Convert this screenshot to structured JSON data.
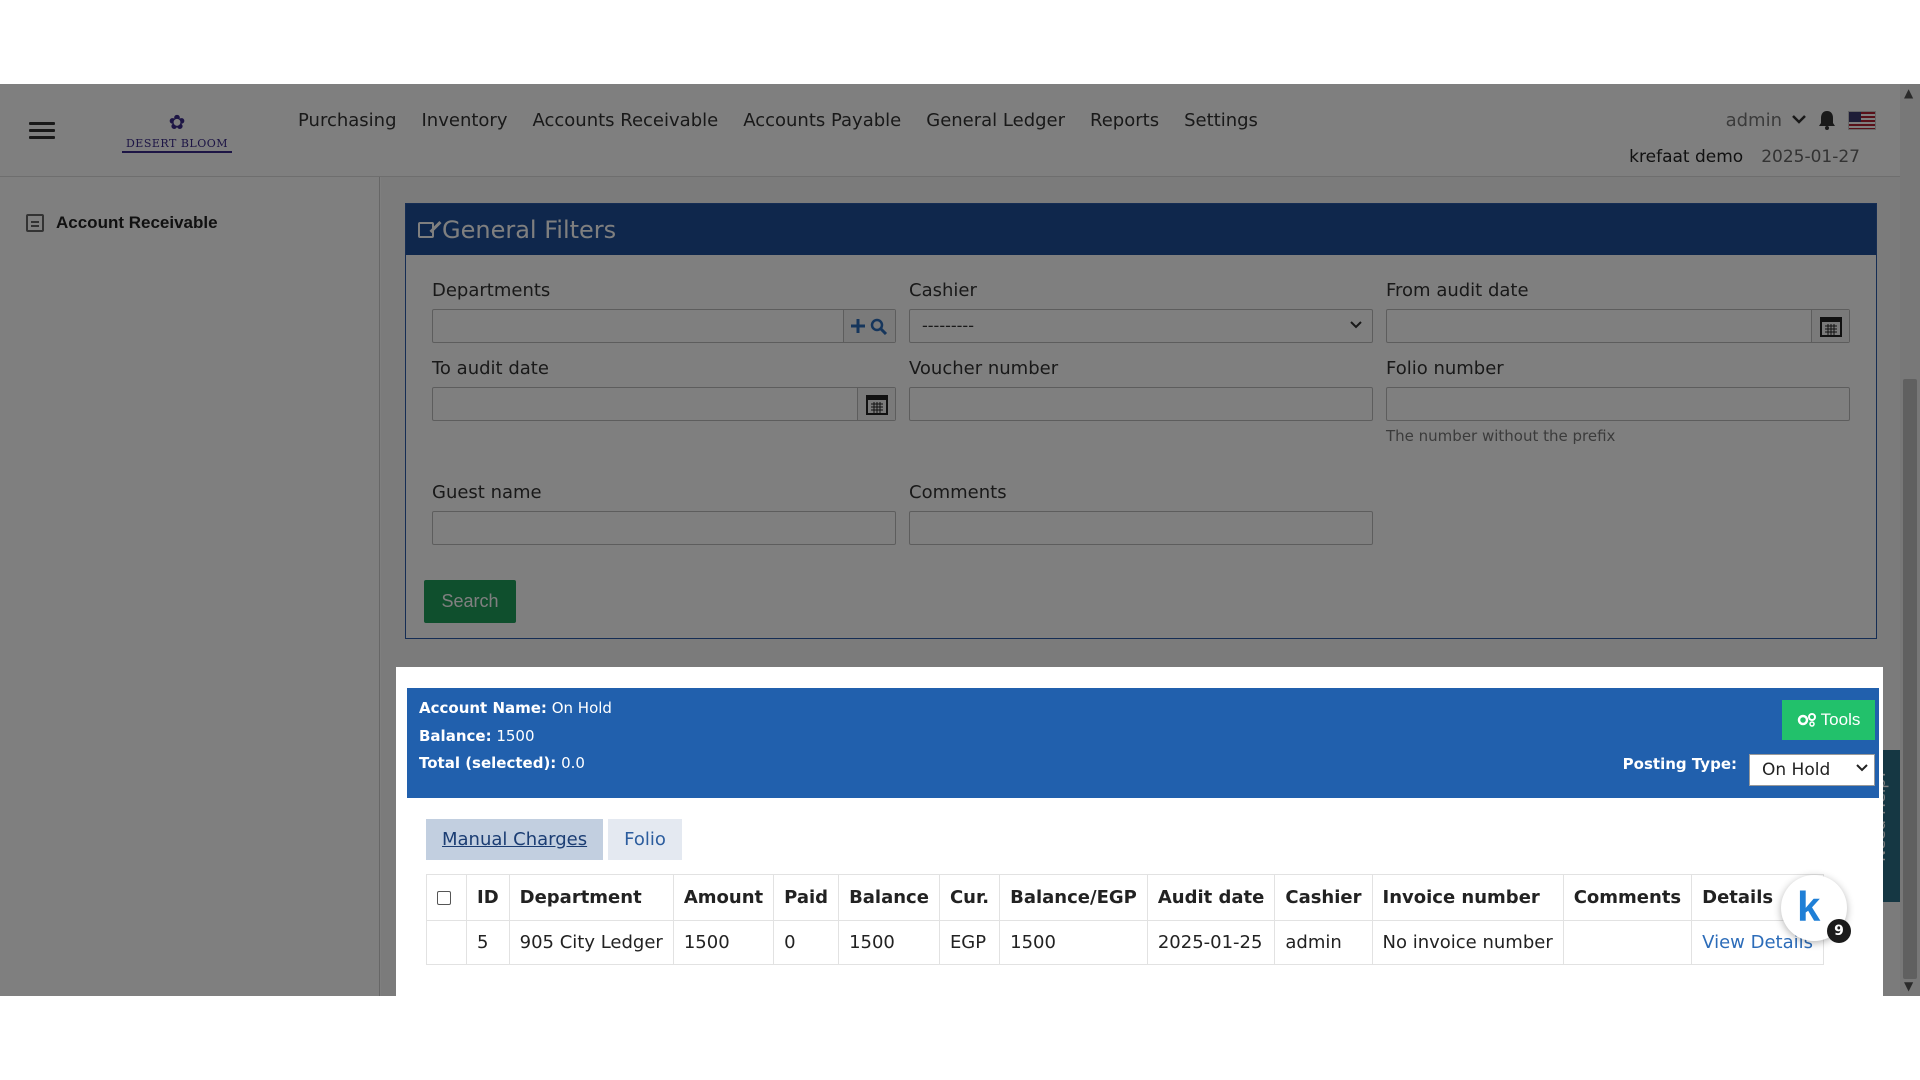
{
  "nav": {
    "logo_text": "DESERT BLOOM",
    "menu": [
      "Purchasing",
      "Inventory",
      "Accounts Receivable",
      "Accounts Payable",
      "General Ledger",
      "Reports",
      "Settings"
    ],
    "user": "admin",
    "tenant": "krefaat demo",
    "date": "2025-01-27"
  },
  "sidebar": {
    "item": "Account Receivable"
  },
  "filters": {
    "title": "General Filters",
    "departments_label": "Departments",
    "cashier_label": "Cashier",
    "cashier_value": "---------",
    "from_audit_label": "From audit date",
    "to_audit_label": "To audit date",
    "voucher_label": "Voucher number",
    "folio_label": "Folio number",
    "folio_hint": "The number without the prefix",
    "guest_label": "Guest name",
    "comments_label": "Comments",
    "search_label": "Search"
  },
  "account": {
    "name_label": "Account Name:",
    "name_value": "On Hold",
    "balance_label": "Balance:",
    "balance_value": "1500",
    "total_label": "Total (selected):",
    "total_value": "0.0",
    "tools_label": "Tools",
    "posting_label": "Posting Type:",
    "posting_value": "On Hold"
  },
  "tabs": [
    "Manual Charges",
    "Folio"
  ],
  "table": {
    "headers": [
      "ID",
      "Department",
      "Amount",
      "Paid",
      "Balance",
      "Cur.",
      "Balance/EGP",
      "Audit date",
      "Cashier",
      "Invoice number",
      "Comments",
      "Details"
    ],
    "rows": [
      [
        "5",
        "905 City Ledger",
        "1500",
        "0",
        "1500",
        "EGP",
        "1500",
        "2025-01-25",
        "admin",
        "No invoice number",
        "",
        "View Details"
      ]
    ]
  },
  "help_tab": "Need Help?",
  "widget": {
    "letter": "k",
    "badge": "9"
  },
  "colors": {
    "header_blue": "#1f4f99",
    "account_blue": "#2160ad",
    "green": "#1e9e5a",
    "tools_green": "#22c16b"
  }
}
